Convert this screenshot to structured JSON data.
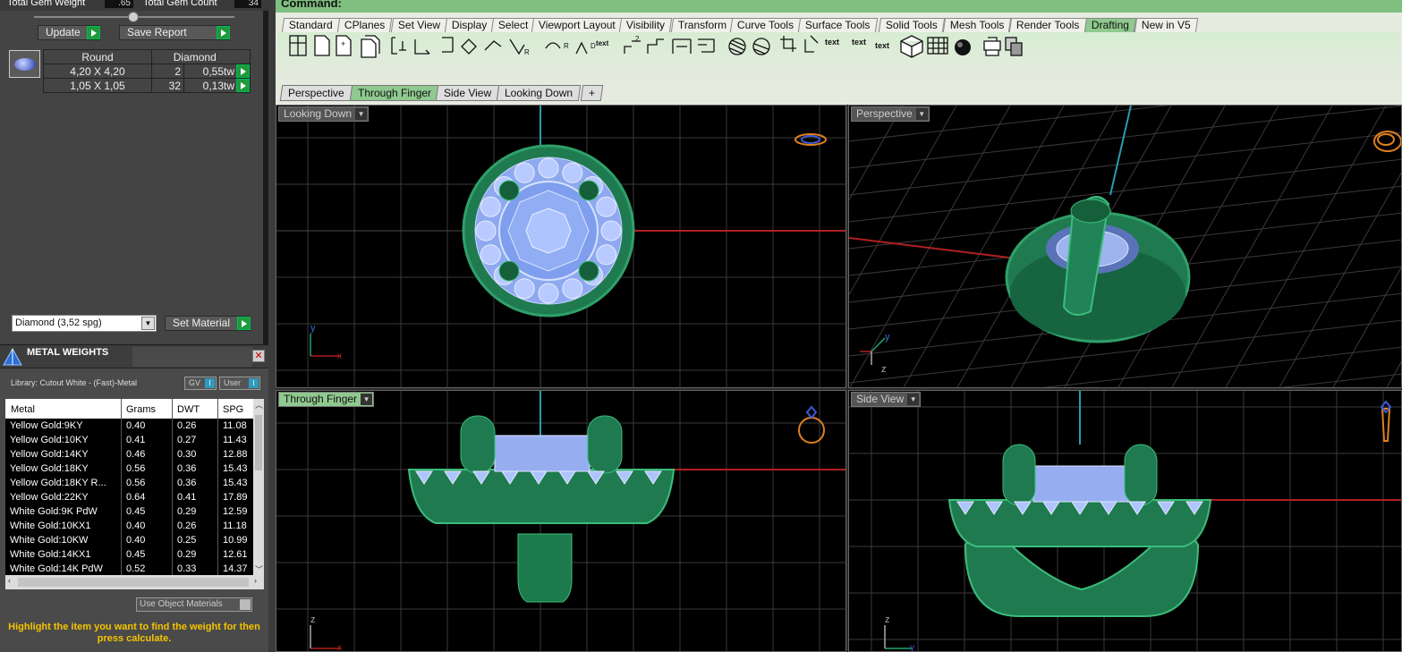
{
  "gem_summary": {
    "total_weight_label": "Total Gem Weight",
    "total_weight_value": ".65",
    "total_count_label": "Total Gem Count",
    "total_count_value": "34"
  },
  "gem_buttons": {
    "update": "Update",
    "save_report": "Save Report"
  },
  "gem_table": {
    "header": {
      "shape": "Round",
      "material": "Diamond"
    },
    "rows": [
      {
        "size": "4,20 X 4,20",
        "count": "2",
        "weight": "0,55tw"
      },
      {
        "size": "1,05 X 1,05",
        "count": "32",
        "weight": "0,13tw"
      }
    ]
  },
  "material_select": {
    "value": "Diamond   (3,52 spg)",
    "button": "Set Material"
  },
  "metal_weights": {
    "title": "METAL WEIGHTS",
    "library": "Library: Cutout White - (Fast)-Metal",
    "gv_label": "GV",
    "user_label": "User",
    "columns": [
      "Metal",
      "Grams",
      "DWT",
      "SPG"
    ],
    "rows": [
      [
        "Yellow Gold:9KY",
        "0.40",
        "0.26",
        "11.08"
      ],
      [
        "Yellow Gold:10KY",
        "0.41",
        "0.27",
        "11.43"
      ],
      [
        "Yellow Gold:14KY",
        "0.46",
        "0.30",
        "12.88"
      ],
      [
        "Yellow Gold:18KY",
        "0.56",
        "0.36",
        "15.43"
      ],
      [
        "Yellow Gold:18KY R...",
        "0.56",
        "0.36",
        "15.43"
      ],
      [
        "Yellow Gold:22KY",
        "0.64",
        "0.41",
        "17.89"
      ],
      [
        "White Gold:9K PdW",
        "0.45",
        "0.29",
        "12.59"
      ],
      [
        "White Gold:10KX1",
        "0.40",
        "0.26",
        "11.18"
      ],
      [
        "White Gold:10KW",
        "0.40",
        "0.25",
        "10.99"
      ],
      [
        "White Gold:14KX1",
        "0.45",
        "0.29",
        "12.61"
      ],
      [
        "White Gold:14K PdW",
        "0.52",
        "0.33",
        "14.37"
      ]
    ],
    "use_object_materials": "Use Object Materials",
    "hint": "Highlight the item you want to find the weight for then press calculate."
  },
  "command": {
    "label": "Command:"
  },
  "toolbar_tabs": [
    "Standard",
    "CPlanes",
    "Set View",
    "Display",
    "Select",
    "Viewport Layout",
    "Visibility",
    "Transform",
    "Curve Tools",
    "Surface Tools",
    "Solid Tools",
    "Mesh Tools",
    "Render Tools",
    "Drafting",
    "New in V5"
  ],
  "active_toolbar_tab": "Drafting",
  "toolbar_icons": [
    "text",
    "text",
    "text",
    "text"
  ],
  "viewport_tabs": [
    "Perspective",
    "Through Finger",
    "Side View",
    "Looking Down"
  ],
  "viewport_add": "+",
  "viewports": {
    "top_left": "Looking Down",
    "top_right": "Perspective",
    "bottom_left": "Through Finger",
    "bottom_right": "Side View"
  },
  "axis_labels": {
    "x": "x",
    "y": "y",
    "z": "z"
  },
  "colors": {
    "accent_green": "#8fc98f",
    "model_green": "#1f7a4f",
    "gem_blue": "#9fb7ff",
    "hint_yellow": "#f5c400"
  }
}
